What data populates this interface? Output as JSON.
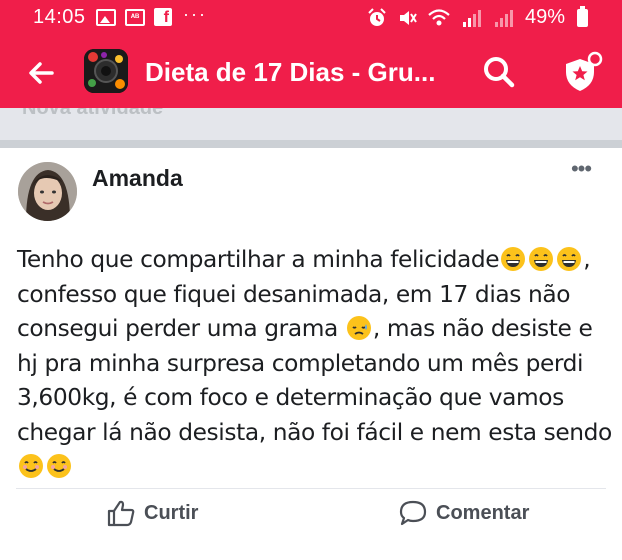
{
  "status_bar": {
    "time": "14:05",
    "battery": "49%",
    "notification_icons": [
      "gallery-icon",
      "message-icon",
      "facebook-icon",
      "more-dots-icon"
    ],
    "system_icons": [
      "alarm-icon",
      "mute-icon",
      "wifi-icon",
      "signal-icon",
      "signal-icon",
      "battery-icon"
    ]
  },
  "app_bar": {
    "title": "Dieta de 17 Dias - Gru...",
    "color": "#f01e4a"
  },
  "previous_strip": {
    "text": "Nova atividade"
  },
  "post": {
    "author": "Amanda",
    "text_1": "Tenho que compartilhar a minha felicidade",
    "text_2": ", confesso que fiquei desanimada, em 17 dias não consegui perder uma grama ",
    "text_3": ", mas não desiste e hj pra minha surpresa completando um mês perdi 3,600kg, é com foco e determinação que vamos chegar lá não desista, não foi fácil e nem esta sendo ",
    "emojis": [
      "grinning-face",
      "grinning-face",
      "grinning-face",
      "sad-relieved-face",
      "smiling-face",
      "smiling-face"
    ]
  },
  "actions": {
    "like_label": "Curtir",
    "comment_label": "Comentar"
  }
}
